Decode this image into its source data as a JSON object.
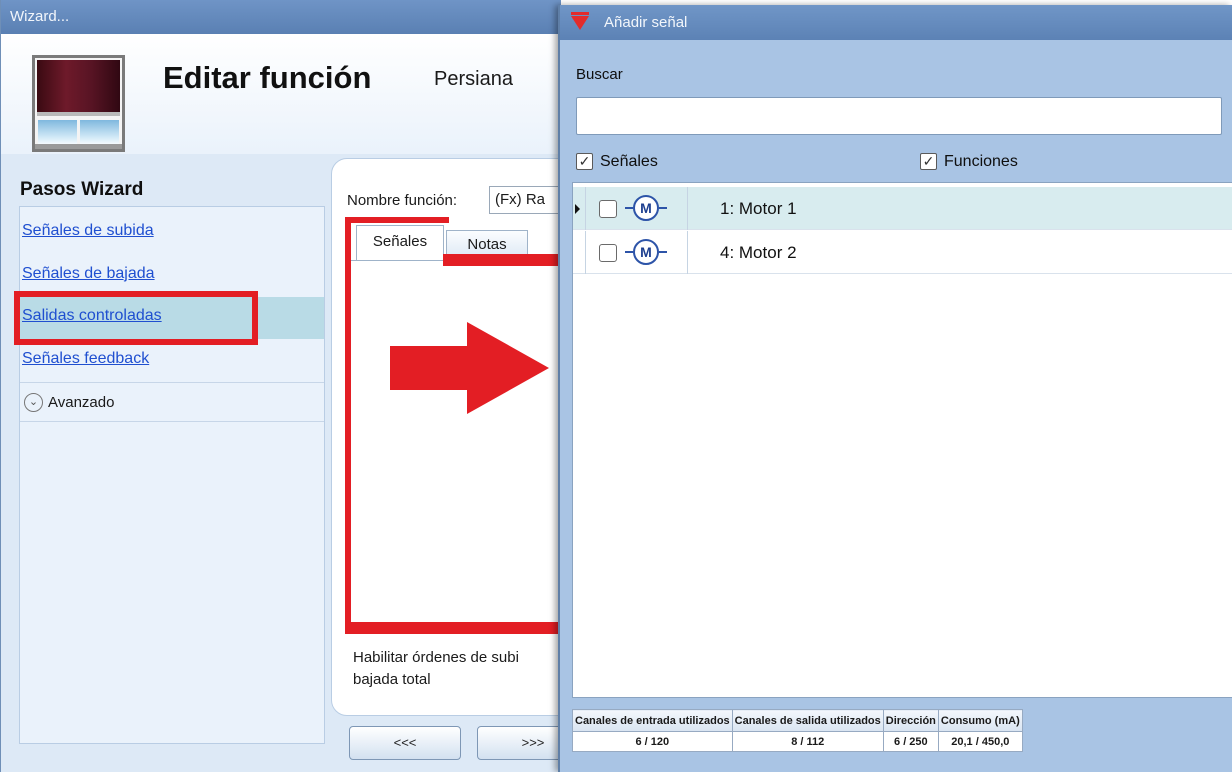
{
  "wizard": {
    "title": "Wizard...",
    "function_title": "Editar función",
    "function_type": "Persiana",
    "steps_title": "Pasos Wizard",
    "steps": [
      {
        "label": "Señales de subida"
      },
      {
        "label": "Señales de bajada"
      },
      {
        "label": "Salidas controladas"
      },
      {
        "label": "Señales feedback"
      }
    ],
    "advanced_label": "Avanzado",
    "name_label": "Nombre función:",
    "name_value": "(Fx) Ra",
    "tabs": [
      {
        "label": "Señales"
      },
      {
        "label": "Notas"
      }
    ],
    "help_text": "Habilitar órdenes de subi\nbajada total",
    "prev_label": "<<<",
    "next_label": ">>>"
  },
  "add_signal": {
    "title": "Añadir señal",
    "search_label": "Buscar",
    "search_value": "",
    "filters": [
      {
        "label": "Señales",
        "checked": true
      },
      {
        "label": "Funciones",
        "checked": true
      }
    ],
    "items": [
      {
        "icon": "motor-icon",
        "label": "1: Motor 1",
        "checked": false,
        "selected": true
      },
      {
        "icon": "motor-icon",
        "label": "4: Motor 2",
        "checked": false,
        "selected": false
      }
    ],
    "status": {
      "headers": [
        "Canales de entrada utilizados",
        "Canales de salida utilizados",
        "Dirección",
        "Consumo (mA)"
      ],
      "values": [
        "6 / 120",
        "8 / 112",
        "6 / 250",
        "20,1 / 450,0"
      ]
    }
  },
  "colors": {
    "highlight": "#e31e24",
    "titlebar": "#5f86ba",
    "link": "#1f4fd0",
    "selected_row": "#d8ecef",
    "active_step": "#b9dbe6"
  }
}
